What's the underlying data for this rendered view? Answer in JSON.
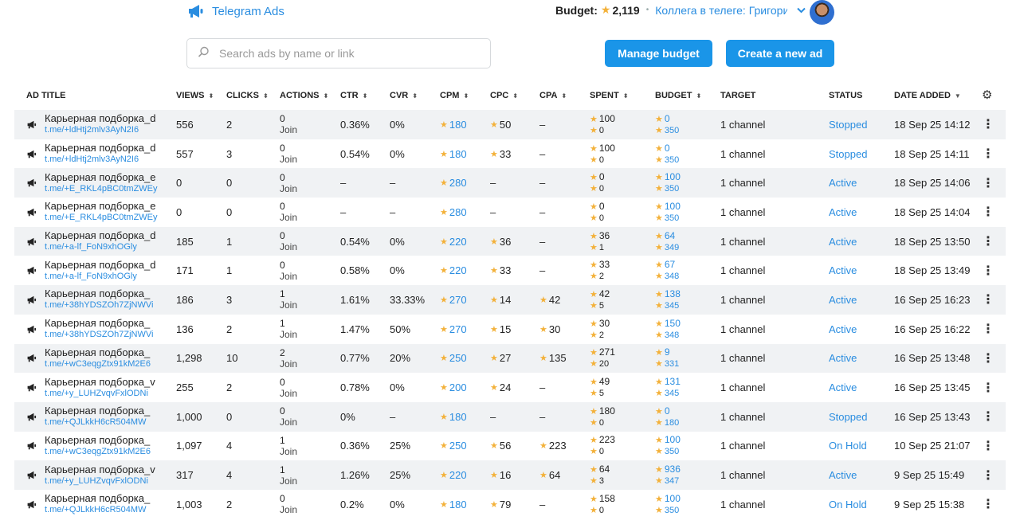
{
  "header": {
    "brand": "Telegram Ads",
    "budget_label": "Budget:",
    "budget_value": "2,119",
    "account": "Коллега в телеге: Григорий",
    "icons": {
      "brand": "megaphone-icon",
      "chevron": "chevron-down-icon",
      "avatar": "avatar"
    }
  },
  "search": {
    "placeholder": "Search ads by name or link"
  },
  "buttons": {
    "manage": "Manage budget",
    "create": "Create a new ad"
  },
  "columns": {
    "ad_title": "AD TITLE",
    "views": "VIEWS",
    "clicks": "CLICKS",
    "actions": "ACTIONS",
    "ctr": "CTR",
    "cvr": "CVR",
    "cpm": "CPM",
    "cpc": "CPC",
    "cpa": "CPA",
    "spent": "SPENT",
    "budget": "BUDGET",
    "target": "TARGET",
    "status": "STATUS",
    "date_added": "DATE ADDED"
  },
  "colors": {
    "accent": "#1a95e8",
    "link": "#2a8de0",
    "star": "#f3b13a",
    "row_alt": "#f0f2f4"
  },
  "rows": [
    {
      "title": "Карьерная подборка_d",
      "link": "t.me/+ldHtj2mlv3AyN2I6",
      "views": "556",
      "clicks": "2",
      "actions": "0",
      "action_type": "Join",
      "ctr": "0.36%",
      "cvr": "0%",
      "cpm": "180",
      "cpc": "50",
      "cpa": "–",
      "spent_top": "100",
      "spent_bottom": "0",
      "budget_top": "0",
      "budget_bottom": "350",
      "target": "1 channel",
      "status": "Stopped",
      "date": "18 Sep 25 14:12"
    },
    {
      "title": "Карьерная подборка_d",
      "link": "t.me/+ldHtj2mlv3AyN2I6",
      "views": "557",
      "clicks": "3",
      "actions": "0",
      "action_type": "Join",
      "ctr": "0.54%",
      "cvr": "0%",
      "cpm": "180",
      "cpc": "33",
      "cpa": "–",
      "spent_top": "100",
      "spent_bottom": "0",
      "budget_top": "0",
      "budget_bottom": "350",
      "target": "1 channel",
      "status": "Stopped",
      "date": "18 Sep 25 14:11"
    },
    {
      "title": "Карьерная подборка_e",
      "link": "t.me/+E_RKL4pBC0tmZWEy",
      "views": "0",
      "clicks": "0",
      "actions": "0",
      "action_type": "Join",
      "ctr": "–",
      "cvr": "–",
      "cpm": "280",
      "cpc": "–",
      "cpa": "–",
      "spent_top": "0",
      "spent_bottom": "0",
      "budget_top": "100",
      "budget_bottom": "350",
      "target": "1 channel",
      "status": "Active",
      "date": "18 Sep 25 14:06"
    },
    {
      "title": "Карьерная подборка_e",
      "link": "t.me/+E_RKL4pBC0tmZWEy",
      "views": "0",
      "clicks": "0",
      "actions": "0",
      "action_type": "Join",
      "ctr": "–",
      "cvr": "–",
      "cpm": "280",
      "cpc": "–",
      "cpa": "–",
      "spent_top": "0",
      "spent_bottom": "0",
      "budget_top": "100",
      "budget_bottom": "350",
      "target": "1 channel",
      "status": "Active",
      "date": "18 Sep 25 14:04"
    },
    {
      "title": "Карьерная подборка_d",
      "link": "t.me/+a-lf_FoN9xhOGly",
      "views": "185",
      "clicks": "1",
      "actions": "0",
      "action_type": "Join",
      "ctr": "0.54%",
      "cvr": "0%",
      "cpm": "220",
      "cpc": "36",
      "cpa": "–",
      "spent_top": "36",
      "spent_bottom": "1",
      "budget_top": "64",
      "budget_bottom": "349",
      "target": "1 channel",
      "status": "Active",
      "date": "18 Sep 25 13:50"
    },
    {
      "title": "Карьерная подборка_d",
      "link": "t.me/+a-lf_FoN9xhOGly",
      "views": "171",
      "clicks": "1",
      "actions": "0",
      "action_type": "Join",
      "ctr": "0.58%",
      "cvr": "0%",
      "cpm": "220",
      "cpc": "33",
      "cpa": "–",
      "spent_top": "33",
      "spent_bottom": "2",
      "budget_top": "67",
      "budget_bottom": "348",
      "target": "1 channel",
      "status": "Active",
      "date": "18 Sep 25 13:49"
    },
    {
      "title": "Карьерная подборка_",
      "link": "t.me/+38hYDSZOh7ZjNWVi",
      "views": "186",
      "clicks": "3",
      "actions": "1",
      "action_type": "Join",
      "ctr": "1.61%",
      "cvr": "33.33%",
      "cpm": "270",
      "cpc": "14",
      "cpa": "42",
      "spent_top": "42",
      "spent_bottom": "5",
      "budget_top": "138",
      "budget_bottom": "345",
      "target": "1 channel",
      "status": "Active",
      "date": "16 Sep 25 16:23"
    },
    {
      "title": "Карьерная подборка_",
      "link": "t.me/+38hYDSZOh7ZjNWVi",
      "views": "136",
      "clicks": "2",
      "actions": "1",
      "action_type": "Join",
      "ctr": "1.47%",
      "cvr": "50%",
      "cpm": "270",
      "cpc": "15",
      "cpa": "30",
      "spent_top": "30",
      "spent_bottom": "2",
      "budget_top": "150",
      "budget_bottom": "348",
      "target": "1 channel",
      "status": "Active",
      "date": "16 Sep 25 16:22"
    },
    {
      "title": "Карьерная подборка_",
      "link": "t.me/+wC3eqgZtx91kM2E6",
      "views": "1,298",
      "clicks": "10",
      "actions": "2",
      "action_type": "Join",
      "ctr": "0.77%",
      "cvr": "20%",
      "cpm": "250",
      "cpc": "27",
      "cpa": "135",
      "spent_top": "271",
      "spent_bottom": "20",
      "budget_top": "9",
      "budget_bottom": "331",
      "target": "1 channel",
      "status": "Active",
      "date": "16 Sep 25 13:48"
    },
    {
      "title": "Карьерная подборка_v",
      "link": "t.me/+y_LUHZvqvFxlODNi",
      "views": "255",
      "clicks": "2",
      "actions": "0",
      "action_type": "Join",
      "ctr": "0.78%",
      "cvr": "0%",
      "cpm": "200",
      "cpc": "24",
      "cpa": "–",
      "spent_top": "49",
      "spent_bottom": "5",
      "budget_top": "131",
      "budget_bottom": "345",
      "target": "1 channel",
      "status": "Active",
      "date": "16 Sep 25 13:45"
    },
    {
      "title": "Карьерная подборка_",
      "link": "t.me/+QJLkkH6cR504MW",
      "views": "1,000",
      "clicks": "0",
      "actions": "0",
      "action_type": "Join",
      "ctr": "0%",
      "cvr": "–",
      "cpm": "180",
      "cpc": "–",
      "cpa": "–",
      "spent_top": "180",
      "spent_bottom": "0",
      "budget_top": "0",
      "budget_bottom": "180",
      "target": "1 channel",
      "status": "Stopped",
      "date": "16 Sep 25 13:43"
    },
    {
      "title": "Карьерная подборка_",
      "link": "t.me/+wC3eqgZtx91kM2E6",
      "views": "1,097",
      "clicks": "4",
      "actions": "1",
      "action_type": "Join",
      "ctr": "0.36%",
      "cvr": "25%",
      "cpm": "250",
      "cpc": "56",
      "cpa": "223",
      "spent_top": "223",
      "spent_bottom": "0",
      "budget_top": "100",
      "budget_bottom": "350",
      "target": "1 channel",
      "status": "On Hold",
      "date": "10 Sep 25 21:07"
    },
    {
      "title": "Карьерная подборка_v",
      "link": "t.me/+y_LUHZvqvFxlODNi",
      "views": "317",
      "clicks": "4",
      "actions": "1",
      "action_type": "Join",
      "ctr": "1.26%",
      "cvr": "25%",
      "cpm": "220",
      "cpc": "16",
      "cpa": "64",
      "spent_top": "64",
      "spent_bottom": "3",
      "budget_top": "936",
      "budget_bottom": "347",
      "target": "1 channel",
      "status": "Active",
      "date": "9 Sep 25 15:49"
    },
    {
      "title": "Карьерная подборка_",
      "link": "t.me/+QJLkkH6cR504MW",
      "views": "1,003",
      "clicks": "2",
      "actions": "0",
      "action_type": "Join",
      "ctr": "0.2%",
      "cvr": "0%",
      "cpm": "180",
      "cpc": "79",
      "cpa": "–",
      "spent_top": "158",
      "spent_bottom": "0",
      "budget_top": "100",
      "budget_bottom": "350",
      "target": "1 channel",
      "status": "On Hold",
      "date": "9 Sep 25 15:38"
    }
  ]
}
